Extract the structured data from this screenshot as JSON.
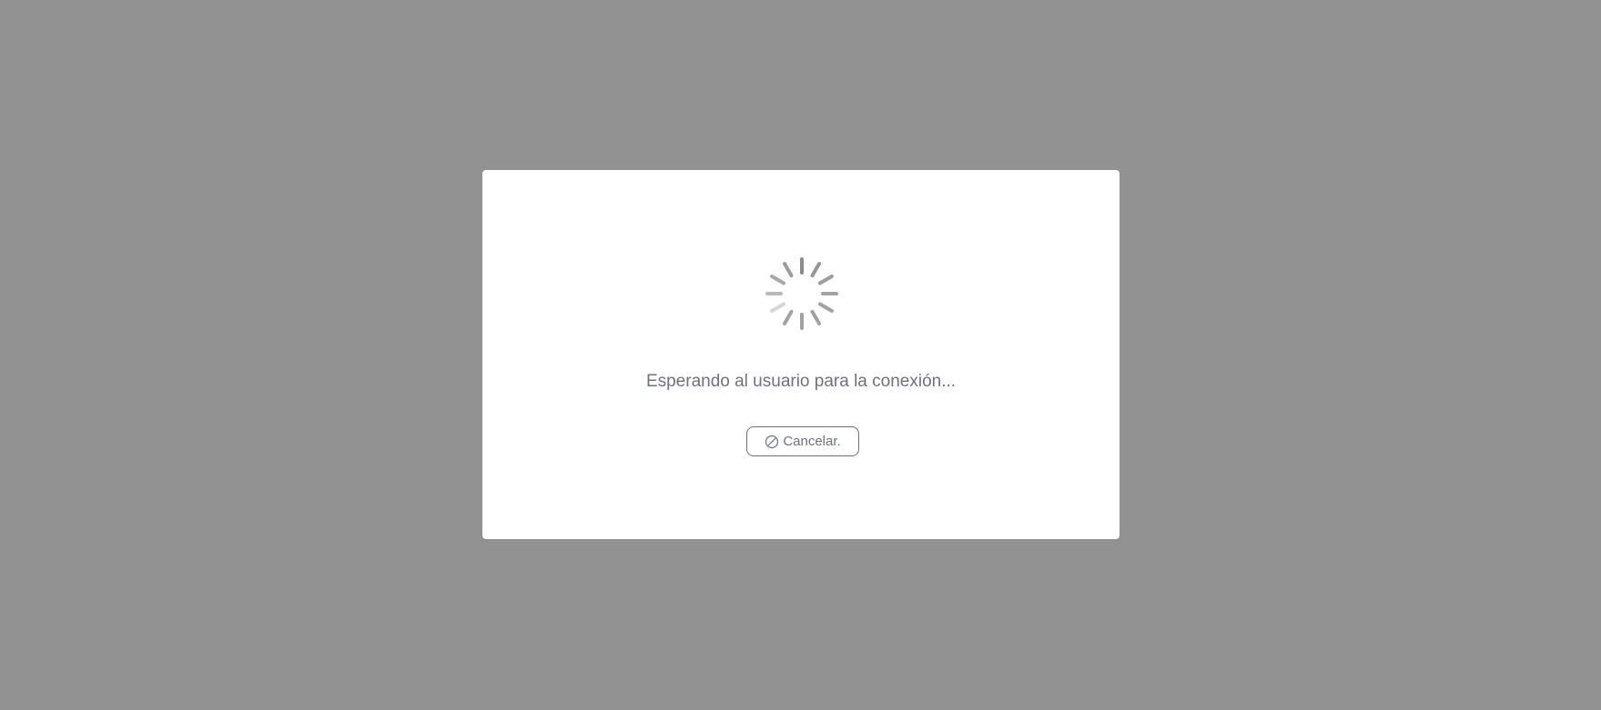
{
  "colors": {
    "overlay": "#929292",
    "dialog_background": "#ffffff",
    "spinner": "#8c8c8c",
    "text": "#6b7280",
    "button_border": "#6f6f6f"
  },
  "dialog": {
    "message": "Esperando al usuario para la conexión...",
    "cancel_button": {
      "label": "Cancelar.",
      "icon": "cancel-icon"
    },
    "spinner_icon": "loading-spinner-icon"
  }
}
